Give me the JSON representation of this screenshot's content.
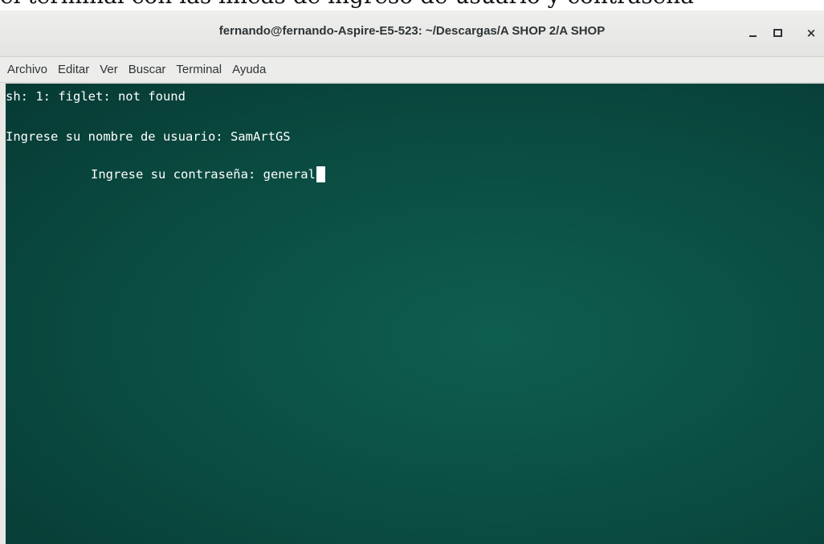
{
  "page_caption": "el terminal con las líneas de ingreso de usuario y contraseña",
  "window": {
    "title": "fernando@fernando-Aspire-E5-523: ~/Descargas/A SHOP 2/A SHOP",
    "controls": {
      "minimize": "minimize-icon",
      "maximize": "maximize-icon",
      "close": "×"
    }
  },
  "menubar": {
    "items": [
      "Archivo",
      "Editar",
      "Ver",
      "Buscar",
      "Terminal",
      "Ayuda"
    ]
  },
  "terminal": {
    "lines": [
      "sh: 1: figlet: not found",
      "Ingrese su nombre de usuario: SamArtGS",
      "Ingrese su contraseña: general"
    ],
    "colors": {
      "background": "#0a4a40",
      "foreground": "#ffffff"
    }
  }
}
